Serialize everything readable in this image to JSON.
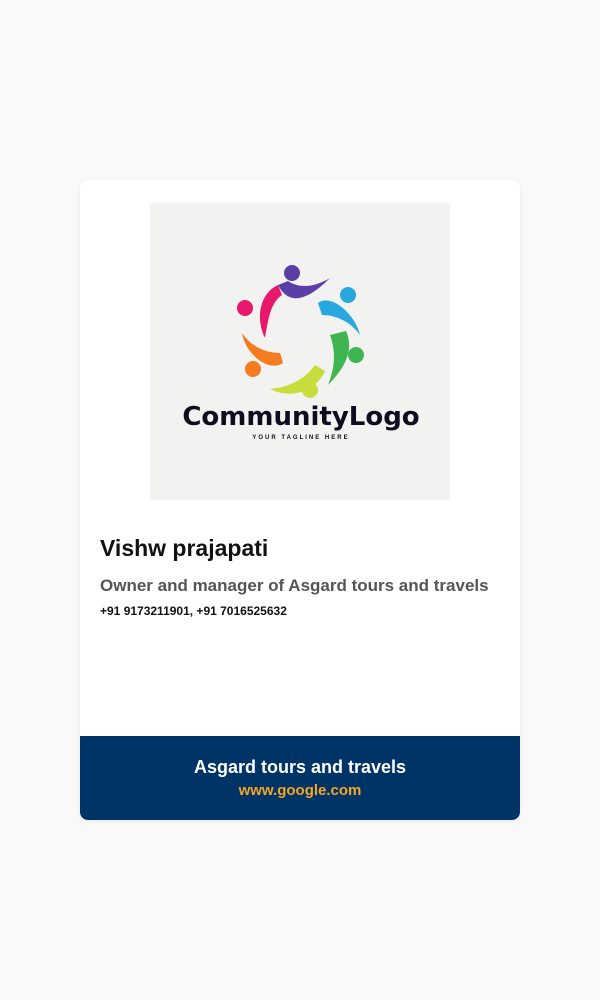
{
  "logo": {
    "wordmark": "CommunityLogo",
    "tagline": "YOUR TAGLINE HERE",
    "icon": "community-people-circle-icon",
    "colors": [
      "#5b3ea6",
      "#29a8e0",
      "#3fb551",
      "#c8dc3c",
      "#f47b20",
      "#e8196d"
    ]
  },
  "profile": {
    "name": "Vishw prajapati",
    "role": "Owner and manager of Asgard tours and travels",
    "phone": "+91 9173211901, +91 7016525632"
  },
  "footer": {
    "company": "Asgard tours and travels",
    "website": "www.google.com",
    "background": "#003366",
    "link_color": "#f5a623"
  }
}
